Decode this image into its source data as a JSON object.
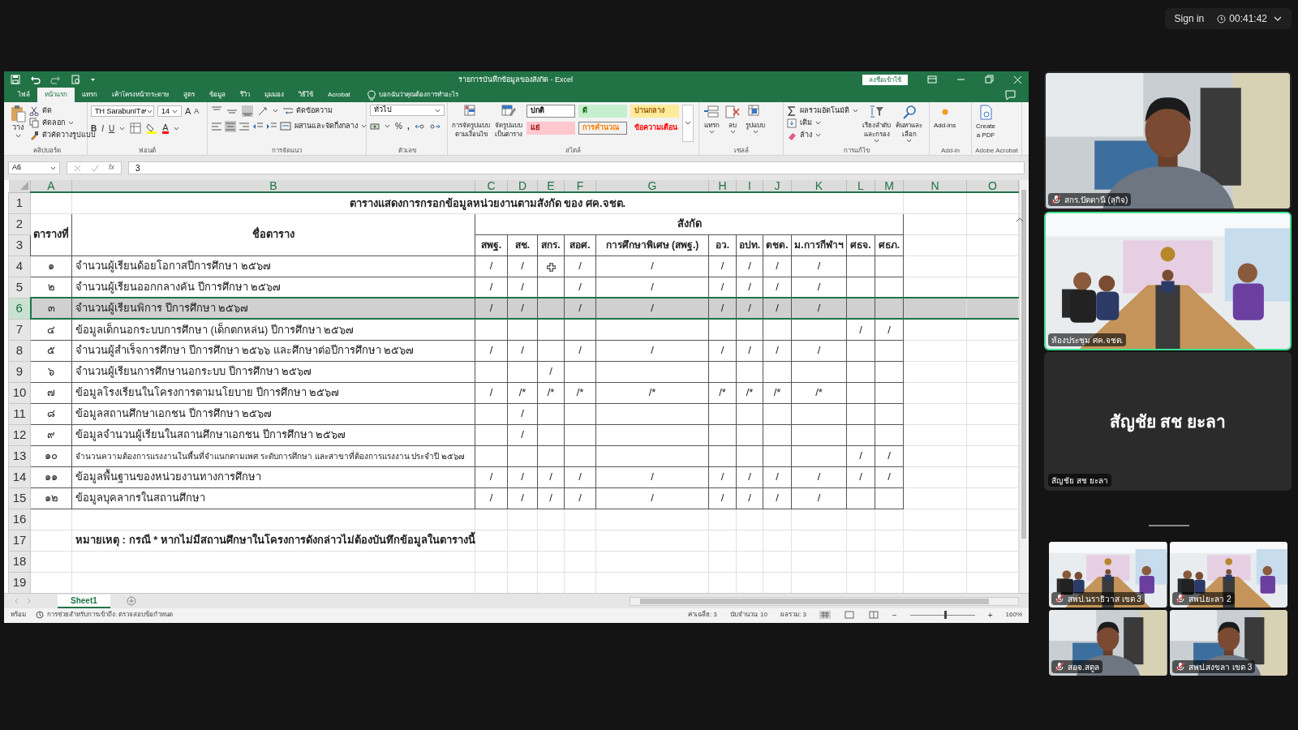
{
  "meeting": {
    "sign_in": "Sign in",
    "timer": "00:41:42"
  },
  "excel": {
    "title": "รายการบันทึกข้อมูลของสังกัด - Excel",
    "sign_in": "ลงชื่อเข้าใช้",
    "tabs": [
      {
        "label": "ไฟล์",
        "selected": false
      },
      {
        "label": "หน้าแรก",
        "selected": true
      },
      {
        "label": "แทรก",
        "selected": false
      },
      {
        "label": "เค้าโครงหน้ากระดาษ",
        "selected": false
      },
      {
        "label": "สูตร",
        "selected": false
      },
      {
        "label": "ข้อมูล",
        "selected": false
      },
      {
        "label": "รีวิว",
        "selected": false
      },
      {
        "label": "มุมมอง",
        "selected": false
      },
      {
        "label": "วิธีใช้",
        "selected": false
      },
      {
        "label": "Acrobat",
        "selected": false
      }
    ],
    "tell_me": "บอกฉันว่าคุณต้องการทำอะไร",
    "ribbon": {
      "clipboard": {
        "label": "คลิปบอร์ด",
        "paste": "วาง",
        "cut": "ตัด",
        "copy": "คัดลอก",
        "painter": "ตัวคัดวางรูปแบบ"
      },
      "font": {
        "label": "ฟอนต์",
        "family": "TH SarabunIT๙",
        "size": "14",
        "grow": "A",
        "shrink": "A",
        "bold": "B",
        "italic": "I",
        "underline": "U",
        "font_color_letter": "A"
      },
      "alignment": {
        "label": "การจัดแนว",
        "wrap": "ตัดข้อความ",
        "merge": "ผสานและจัดกึ่งกลาง"
      },
      "number": {
        "label": "ตัวเลข",
        "format": "ทั่วไป",
        "percent": "%",
        "comma": ","
      },
      "styles": {
        "label": "สไตล์",
        "conditional": [
          "การจัดรูปแบบ",
          "ตามเงื่อนไข"
        ],
        "as_table": [
          "จัดรูปแบบ",
          "เป็นตาราง"
        ],
        "cell_styles": [
          {
            "label": "ปกติ",
            "kind": "normal"
          },
          {
            "label": "ดี",
            "kind": "good"
          },
          {
            "label": "ปานกลาง",
            "kind": "neutral"
          },
          {
            "label": "แย่",
            "kind": "bad"
          },
          {
            "label": "การคำนวณ",
            "kind": "calculation"
          },
          {
            "label": "ข้อความเตือน",
            "kind": "warning"
          }
        ]
      },
      "cells": {
        "label": "เซลล์",
        "insert": "แทรก",
        "delete": "ลบ",
        "format": "รูปแบบ"
      },
      "editing": {
        "label": "การแก้ไข",
        "autosum": "ผลรวมอัตโนมัติ",
        "fill": "เติม",
        "clear": "ล้าง",
        "sort": [
          "เรียงลำดับ",
          "และกรอง"
        ],
        "find": [
          "ค้นหาและ",
          "เลือก"
        ]
      },
      "addin": {
        "label": "Add-in",
        "button": "Add-ins"
      },
      "acrobat": {
        "label": "Adobe Acrobat",
        "button": [
          "Create",
          "a PDF"
        ]
      }
    },
    "name_box": "A6",
    "fx": "fx",
    "formula": "3",
    "column_letters": [
      "A",
      "B",
      "C",
      "D",
      "E",
      "F",
      "G",
      "H",
      "I",
      "J",
      "K",
      "L",
      "M",
      "N",
      "O"
    ],
    "row_numbers": [
      "1",
      "2",
      "3",
      "4",
      "5",
      "6",
      "7",
      "8",
      "9",
      "10",
      "11",
      "12",
      "13",
      "14",
      "15",
      "16",
      "17",
      "18",
      "19"
    ],
    "sheet": {
      "title": "ตารางแสดงการกรอกข้อมูลหน่วยงานตามสังกัด ของ ศค.จชต.",
      "header": {
        "number": "ตารางที่",
        "name": "ชื่อตาราง",
        "group": "สังกัด"
      },
      "units": [
        "สพฐ.",
        "สช.",
        "สกร.",
        "สอศ.",
        "การศึกษาพิเศษ (สพฐ.)",
        "อว.",
        "อปท.",
        "ตชด.",
        "ม.การกีฬาฯ",
        "ศธจ.",
        "ศธภ."
      ],
      "rows": [
        {
          "number": "๑",
          "name": "จำนวนผู้เรียนด้อยโอกาสปีการศึกษา ๒๕๖๗",
          "selected": false,
          "small": false,
          "cells": [
            {
              "marked": true,
              "text": "/"
            },
            {
              "marked": true,
              "text": "/"
            },
            {
              "marked": false
            },
            {
              "marked": true,
              "text": "/"
            },
            {
              "marked": true,
              "text": "/"
            },
            {
              "marked": true,
              "text": "/"
            },
            {
              "marked": true,
              "text": "/"
            },
            {
              "marked": true,
              "text": "/"
            },
            {
              "marked": true,
              "text": "/"
            },
            {
              "marked": false
            },
            {
              "marked": false
            }
          ]
        },
        {
          "number": "๒",
          "name": "จำนวนผู้เรียนออกกลางคัน ปีการศึกษา ๒๕๖๗",
          "selected": false,
          "small": false,
          "cells": [
            {
              "marked": true,
              "text": "/"
            },
            {
              "marked": true,
              "text": "/"
            },
            {
              "marked": false
            },
            {
              "marked": true,
              "text": "/"
            },
            {
              "marked": true,
              "text": "/"
            },
            {
              "marked": true,
              "text": "/"
            },
            {
              "marked": true,
              "text": "/"
            },
            {
              "marked": true,
              "text": "/"
            },
            {
              "marked": true,
              "text": "/"
            },
            {
              "marked": false
            },
            {
              "marked": false
            }
          ]
        },
        {
          "number": "๓",
          "name": "จำนวนผู้เรียนพิการ  ปีการศึกษา ๒๕๖๗",
          "selected": true,
          "small": false,
          "cells": [
            {
              "marked": true,
              "text": "/"
            },
            {
              "marked": true,
              "text": "/"
            },
            {
              "marked": false
            },
            {
              "marked": true,
              "text": "/"
            },
            {
              "marked": true,
              "text": "/"
            },
            {
              "marked": true,
              "text": "/"
            },
            {
              "marked": true,
              "text": "/"
            },
            {
              "marked": true,
              "text": "/"
            },
            {
              "marked": true,
              "text": "/"
            },
            {
              "marked": false
            },
            {
              "marked": false
            }
          ]
        },
        {
          "number": "๔",
          "name": "ข้อมูลเด็กนอกระบบการศึกษา (เด็กตกหล่น) ปีการศึกษา ๒๕๖๗",
          "selected": false,
          "small": false,
          "cells": [
            {
              "marked": false
            },
            {
              "marked": false
            },
            {
              "marked": false
            },
            {
              "marked": false
            },
            {
              "marked": false
            },
            {
              "marked": false
            },
            {
              "marked": false
            },
            {
              "marked": false
            },
            {
              "marked": false
            },
            {
              "marked": true,
              "text": "/"
            },
            {
              "marked": true,
              "text": "/"
            }
          ]
        },
        {
          "number": "๕",
          "name": "จำนวนผู้สำเร็จการศึกษา ปีการศึกษา ๒๕๖๖  และศึกษาต่อปีการศึกษา  ๒๕๖๗",
          "selected": false,
          "small": false,
          "cells": [
            {
              "marked": true,
              "text": "/"
            },
            {
              "marked": true,
              "text": "/"
            },
            {
              "marked": false
            },
            {
              "marked": true,
              "text": "/"
            },
            {
              "marked": true,
              "text": "/"
            },
            {
              "marked": true,
              "text": "/"
            },
            {
              "marked": true,
              "text": "/"
            },
            {
              "marked": true,
              "text": "/"
            },
            {
              "marked": true,
              "text": "/"
            },
            {
              "marked": false
            },
            {
              "marked": false
            }
          ]
        },
        {
          "number": "๖",
          "name": "จำนวนผู้เรียนการศึกษานอกระบบ ปีการศึกษา ๒๕๖๗",
          "selected": false,
          "small": false,
          "cells": [
            {
              "marked": false
            },
            {
              "marked": false
            },
            {
              "marked": true,
              "text": "/"
            },
            {
              "marked": false
            },
            {
              "marked": false
            },
            {
              "marked": false
            },
            {
              "marked": false
            },
            {
              "marked": false
            },
            {
              "marked": false
            },
            {
              "marked": false
            },
            {
              "marked": false
            }
          ]
        },
        {
          "number": "๗",
          "name": "ข้อมูลโรงเรียนในโครงการตามนโยบาย ปีการศึกษา ๒๕๖๗",
          "selected": false,
          "small": false,
          "cells": [
            {
              "marked": true,
              "text": "/"
            },
            {
              "marked": true,
              "text": "/*"
            },
            {
              "marked": true,
              "text": "/*"
            },
            {
              "marked": true,
              "text": "/*"
            },
            {
              "marked": true,
              "text": "/*"
            },
            {
              "marked": true,
              "text": "/*"
            },
            {
              "marked": true,
              "text": "/*"
            },
            {
              "marked": true,
              "text": "/*"
            },
            {
              "marked": true,
              "text": "/*"
            },
            {
              "marked": false
            },
            {
              "marked": false
            }
          ]
        },
        {
          "number": "๘",
          "name": "ข้อมูลสถานศึกษาเอกชน ปีการศึกษา ๒๕๖๗",
          "selected": false,
          "small": false,
          "cells": [
            {
              "marked": false
            },
            {
              "marked": true,
              "text": "/"
            },
            {
              "marked": false
            },
            {
              "marked": false
            },
            {
              "marked": false
            },
            {
              "marked": false
            },
            {
              "marked": false
            },
            {
              "marked": false
            },
            {
              "marked": false
            },
            {
              "marked": false
            },
            {
              "marked": false
            }
          ]
        },
        {
          "number": "๙",
          "name": "ข้อมูลจำนวนผู้เรียนในสถานศึกษาเอกชน ปีการศึกษา ๒๕๖๗",
          "selected": false,
          "small": false,
          "cells": [
            {
              "marked": false
            },
            {
              "marked": true,
              "text": "/"
            },
            {
              "marked": false
            },
            {
              "marked": false
            },
            {
              "marked": false
            },
            {
              "marked": false
            },
            {
              "marked": false
            },
            {
              "marked": false
            },
            {
              "marked": false
            },
            {
              "marked": false
            },
            {
              "marked": false
            }
          ]
        },
        {
          "number": "๑๐",
          "name": "จำนวนความต้องการแรงงานในพื้นที่จำแนกตามเพศ ระดับการศึกษา และสาขาที่ต้องการแรงงาน ประจำปี ๒๕๖๗",
          "selected": false,
          "small": true,
          "cells": [
            {
              "marked": false
            },
            {
              "marked": false
            },
            {
              "marked": false
            },
            {
              "marked": false
            },
            {
              "marked": false
            },
            {
              "marked": false
            },
            {
              "marked": false
            },
            {
              "marked": false
            },
            {
              "marked": false
            },
            {
              "marked": true,
              "text": "/"
            },
            {
              "marked": true,
              "text": "/"
            }
          ]
        },
        {
          "number": "๑๑",
          "name": "ข้อมูลพื้นฐานของหน่วยงานทางการศึกษา",
          "selected": false,
          "small": false,
          "cells": [
            {
              "marked": true,
              "text": "/"
            },
            {
              "marked": true,
              "text": "/"
            },
            {
              "marked": true,
              "text": "/"
            },
            {
              "marked": true,
              "text": "/"
            },
            {
              "marked": true,
              "text": "/"
            },
            {
              "marked": true,
              "text": "/"
            },
            {
              "marked": true,
              "text": "/"
            },
            {
              "marked": true,
              "text": "/"
            },
            {
              "marked": true,
              "text": "/"
            },
            {
              "marked": true,
              "text": "/"
            },
            {
              "marked": true,
              "text": "/"
            }
          ]
        },
        {
          "number": "๑๒",
          "name": "ข้อมูลบุคลากรในสถานศึกษา",
          "selected": false,
          "small": false,
          "cells": [
            {
              "marked": true,
              "text": "/"
            },
            {
              "marked": true,
              "text": "/"
            },
            {
              "marked": true,
              "text": "/"
            },
            {
              "marked": true,
              "text": "/"
            },
            {
              "marked": true,
              "text": "/"
            },
            {
              "marked": true,
              "text": "/"
            },
            {
              "marked": true,
              "text": "/"
            },
            {
              "marked": true,
              "text": "/"
            },
            {
              "marked": true,
              "text": "/"
            },
            {
              "marked": false
            },
            {
              "marked": false
            }
          ]
        }
      ],
      "note": "หมายเหตุ : กรณี * หากไม่มีสถานศึกษาในโครงการดังกล่าวไม่ต้องบันทึกข้อมูลในตารางนี้"
    },
    "sheet_tabs": [
      {
        "label": "Sheet1",
        "selected": true
      }
    ],
    "status": {
      "ready": "พร้อม",
      "accessibility": "การช่วยสำหรับการเข้าถึง: ตรวจสอบข้อกำหนด",
      "average": "ค่าเฉลี่ย: 3",
      "count": "นับจำนวน: 10",
      "sum": "ผลรวม: 3",
      "zoom_out": "−",
      "zoom_in": "+",
      "zoom": "160%",
      "zoom_slider": {
        "level": 0.55
      }
    }
  },
  "participants": [
    {
      "kind": "video",
      "name": "สกร.ปัตตานี (สุกิจ)",
      "muted": true,
      "selected": false
    },
    {
      "kind": "video",
      "name": "ห้องประชุม ศค.จชต.",
      "muted": false,
      "selected": true
    },
    {
      "kind": "name_card",
      "display_name": "สัญชัย สช ยะลา",
      "name": "สัญชัย สช ยะลา",
      "muted": false,
      "selected": false
    }
  ],
  "gallery": [
    {
      "name": "สพป.นราธิวาส เขต 3",
      "muted": true
    },
    {
      "name": "สพป.ยะลา 2",
      "muted": true
    },
    {
      "name": "สอจ.สตูล",
      "muted": true
    },
    {
      "name": "สพป.สงขลา เขต 3",
      "muted": true
    }
  ]
}
